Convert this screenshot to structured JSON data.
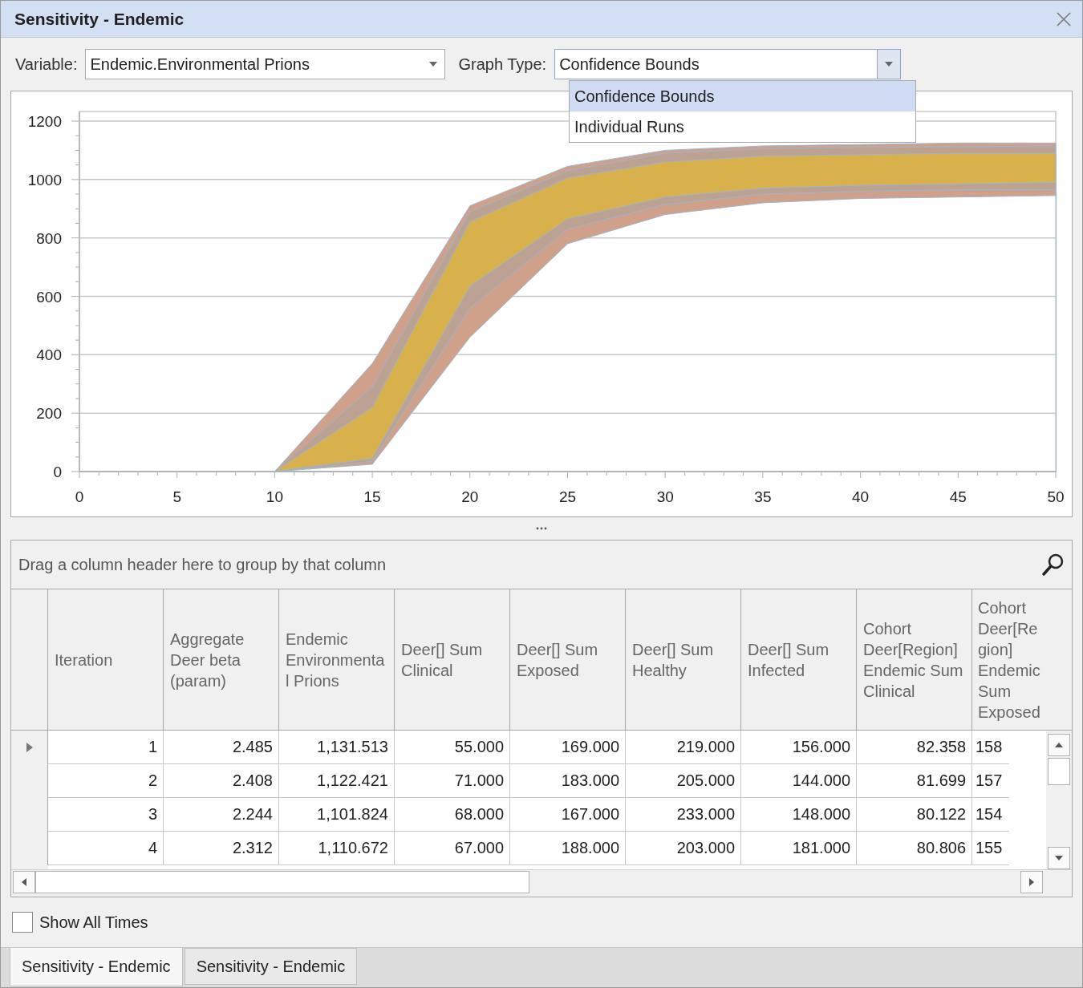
{
  "window": {
    "title": "Sensitivity - Endemic"
  },
  "toolbar": {
    "variable_label": "Variable:",
    "variable_value": "Endemic.Environmental Prions",
    "graph_type_label": "Graph Type:",
    "graph_type_value": "Confidence Bounds",
    "graph_type_options": [
      {
        "label": "Confidence Bounds",
        "selected": true
      },
      {
        "label": "Individual Runs",
        "selected": false
      }
    ]
  },
  "chart": {
    "chart_data": {
      "type": "area",
      "x": [
        0,
        5,
        10,
        15,
        20,
        25,
        30,
        35,
        40,
        45,
        50
      ],
      "xlim": [
        0,
        50
      ],
      "ylim": [
        0,
        1200
      ],
      "xticks": [
        0,
        5,
        10,
        15,
        20,
        25,
        30,
        35,
        40,
        45,
        50
      ],
      "yticks": [
        0,
        200,
        400,
        600,
        800,
        1000,
        1200
      ],
      "grid": true,
      "series": [
        {
          "color": "#ffffff",
          "values": [
            0,
            0,
            0,
            25,
            460,
            780,
            880,
            920,
            935,
            940,
            945
          ]
        },
        {
          "color": "#cfa18b",
          "values": [
            0,
            0,
            0,
            35,
            560,
            830,
            915,
            950,
            960,
            965,
            965
          ]
        },
        {
          "color": "#bba293",
          "values": [
            0,
            0,
            0,
            45,
            635,
            865,
            940,
            970,
            980,
            985,
            990
          ]
        },
        {
          "color": "#d9b14c",
          "values": [
            0,
            0,
            0,
            220,
            855,
            1005,
            1060,
            1080,
            1085,
            1090,
            1090
          ]
        },
        {
          "color": "#bba293",
          "values": [
            0,
            0,
            0,
            290,
            890,
            1030,
            1090,
            1105,
            1110,
            1112,
            1115
          ]
        },
        {
          "color": "#cfa18b",
          "values": [
            0,
            0,
            0,
            370,
            910,
            1045,
            1100,
            1115,
            1120,
            1125,
            1125
          ]
        }
      ]
    }
  },
  "grid": {
    "group_panel_text": "Drag a column header here to group by that column",
    "columns": [
      "Iteration",
      "Aggregate Deer beta (param)",
      "Endemic Environmental Prions",
      "Deer[] Sum Clinical",
      "Deer[] Sum Exposed",
      "Deer[] Sum Healthy",
      "Deer[] Sum Infected",
      "Cohort Deer[Region] Endemic Sum Clinical",
      "Cohort Deer[Region] Endemic Sum Exposed"
    ],
    "rows": [
      {
        "current": true,
        "cells": [
          "1",
          "2.485",
          "1,131.513",
          "55.000",
          "169.000",
          "219.000",
          "156.000",
          "82.358",
          "158"
        ]
      },
      {
        "current": false,
        "cells": [
          "2",
          "2.408",
          "1,122.421",
          "71.000",
          "183.000",
          "205.000",
          "144.000",
          "81.699",
          "157"
        ]
      },
      {
        "current": false,
        "cells": [
          "3",
          "2.244",
          "1,101.824",
          "68.000",
          "167.000",
          "233.000",
          "148.000",
          "80.122",
          "154"
        ]
      },
      {
        "current": false,
        "cells": [
          "4",
          "2.312",
          "1,110.672",
          "67.000",
          "188.000",
          "203.000",
          "181.000",
          "80.806",
          "155"
        ]
      }
    ]
  },
  "show_all_times": {
    "label": "Show All Times",
    "checked": false
  },
  "tabs": [
    {
      "label": "Sensitivity - Endemic",
      "selected": true
    },
    {
      "label": "Sensitivity - Endemic",
      "selected": false
    }
  ]
}
